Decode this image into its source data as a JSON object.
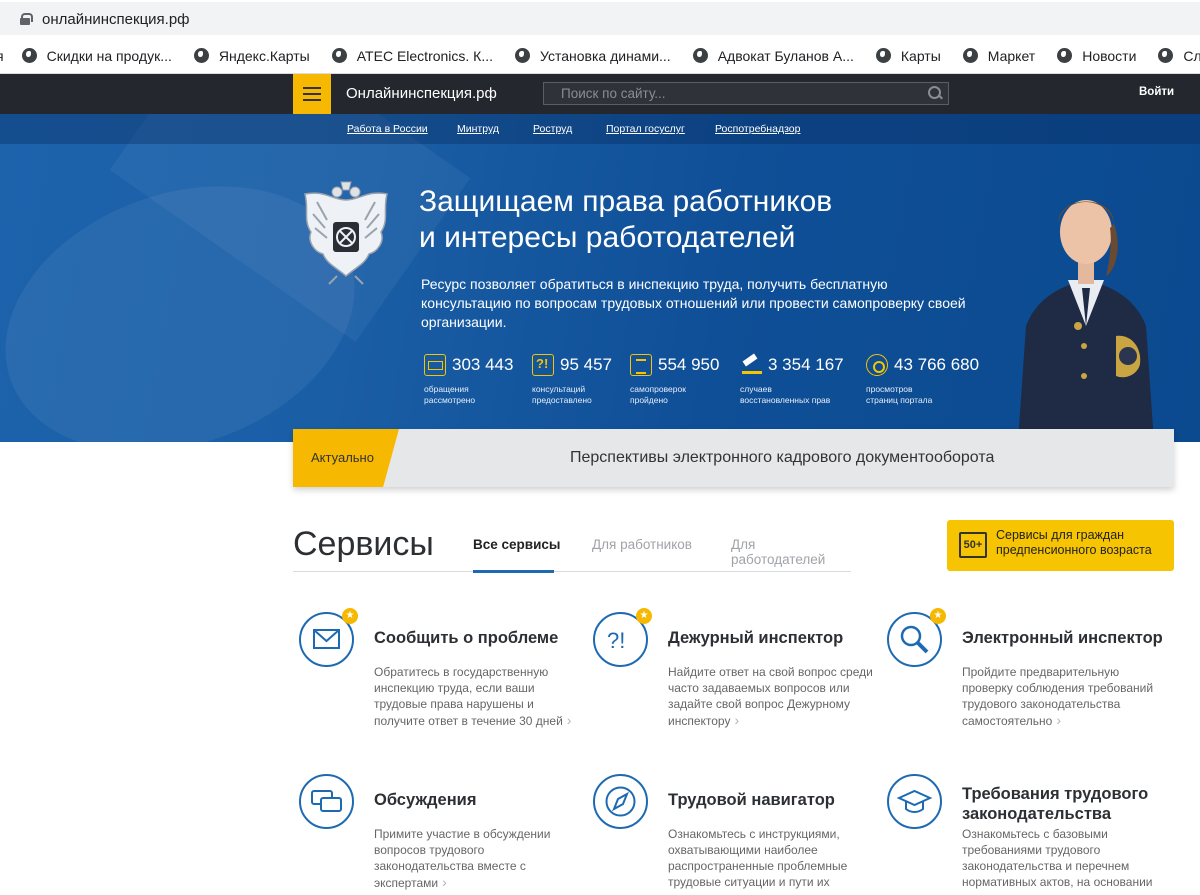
{
  "browser": {
    "url": "онлайнинспекция.рф",
    "bookmarks": [
      {
        "label": "я",
        "icon": "none"
      },
      {
        "label": "Скидки на продук...",
        "icon": "globe-icon"
      },
      {
        "label": "Яндекс.Карты",
        "icon": "globe-icon"
      },
      {
        "label": "ATEC Electronics. К...",
        "icon": "globe-icon"
      },
      {
        "label": "Установка динами...",
        "icon": "globe-icon"
      },
      {
        "label": "Адвокат Буланов А...",
        "icon": "globe-icon"
      },
      {
        "label": "Карты",
        "icon": "globe-icon"
      },
      {
        "label": "Маркет",
        "icon": "globe-icon"
      },
      {
        "label": "Новости",
        "icon": "globe-icon"
      },
      {
        "label": "Словари",
        "icon": "globe-icon"
      }
    ]
  },
  "header": {
    "site_name": "Онлайнинспекция.рф",
    "search_placeholder": "Поиск по сайту...",
    "login": "Войти"
  },
  "subnav": [
    "Работа в России",
    "Минтруд",
    "Роструд",
    "Портал госуслуг",
    "Роспотребнадзор"
  ],
  "hero": {
    "title_line1": "Защищаем права работников",
    "title_line2": "и интересы работодателей",
    "description": "Ресурс позволяет обратиться в инспекцию труда, получить бесплатную консультацию по вопросам трудовых отношений или провести самопроверку своей организации.",
    "stats": [
      {
        "value": "303 443",
        "label1": "обращения",
        "label2": "рассмотрено",
        "icon": "mail-icon"
      },
      {
        "value": "95 457",
        "label1": "консультаций",
        "label2": "предоставлено",
        "icon": "question-icon"
      },
      {
        "value": "554 950",
        "label1": "самопроверок",
        "label2": "пройдено",
        "icon": "checklist-icon"
      },
      {
        "value": "3 354 167",
        "label1": "случаев",
        "label2": "восстановленных прав",
        "icon": "gavel-icon"
      },
      {
        "value": "43 766 680",
        "label1": "просмотров",
        "label2": "страниц портала",
        "icon": "eye-icon"
      }
    ]
  },
  "actual": {
    "tag": "Актуально",
    "text": "Перспективы электронного кадрового документооборота"
  },
  "services": {
    "title": "Сервисы",
    "tabs": [
      "Все сервисы",
      "Для работников",
      "Для работодателей"
    ],
    "active_tab": "Все сервисы",
    "promo": {
      "badge": "50+",
      "text": "Сервисы для граждан предпенсионного возраста"
    },
    "cards": [
      {
        "title": "Сообщить о проблеме",
        "desc": "Обратитесь в государственную инспекцию труда, если ваши трудовые права нарушены и получите ответ в течение 30 дней",
        "icon": "envelope-icon",
        "star": true
      },
      {
        "title": "Дежурный инспектор",
        "desc": "Найдите ответ на свой вопрос среди часто задаваемых вопросов или задайте свой вопрос Дежурному инспектору",
        "icon": "question-exclaim-icon",
        "star": true
      },
      {
        "title": "Электронный инспектор",
        "desc": "Пройдите предварительную проверку соблюдения требований трудового законодательства самостоятельно",
        "icon": "magnifier-icon",
        "star": true
      },
      {
        "title": "Обсуждения",
        "desc": "Примите участие в обсуждении вопросов трудового законодательства вместе с экспертами",
        "icon": "chat-icon",
        "star": false
      },
      {
        "title": "Трудовой навигатор",
        "desc": "Ознакомьтесь с инструкциями, охватывающими наиболее распространенные проблемные трудовые ситуации и пути их",
        "icon": "compass-icon",
        "star": false
      },
      {
        "title": "Требования трудового законодательства",
        "desc": "Ознакомьтесь с базовыми требованиями трудового законодательства и перечнем нормативных актов, на основании",
        "icon": "graduation-cap-icon",
        "star": false
      }
    ]
  },
  "colors": {
    "accent": "#f6b800",
    "header_bg": "#24272d",
    "hero_blue": "#1a5ea6",
    "icon_blue": "#1e6ab2"
  }
}
